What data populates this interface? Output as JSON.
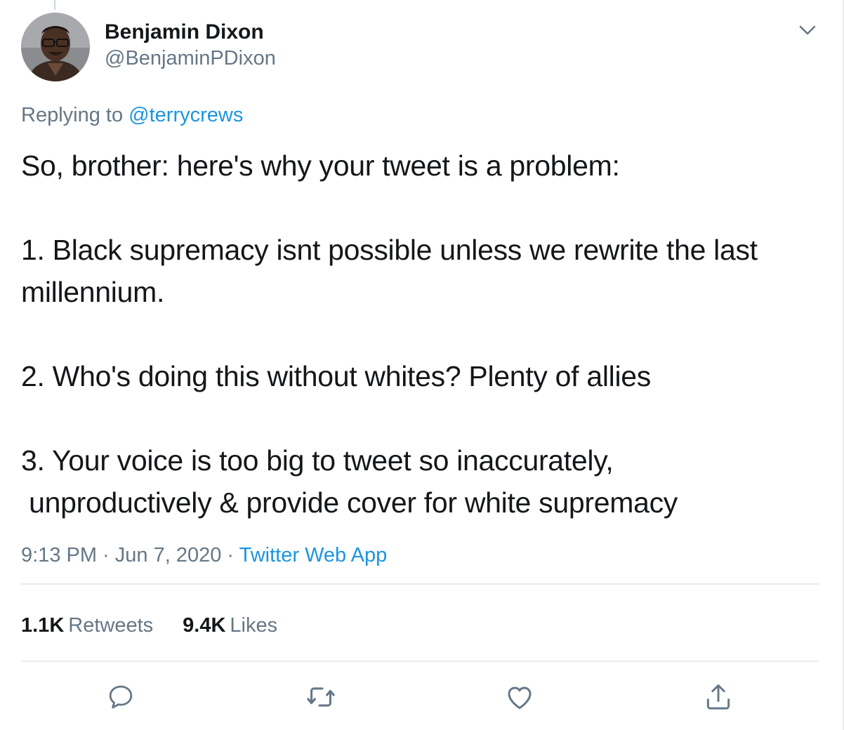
{
  "author": {
    "display_name": "Benjamin Dixon",
    "handle": "@BenjaminPDixon"
  },
  "reply": {
    "prefix": "Replying to ",
    "to_handle": "@terrycrews"
  },
  "tweet": {
    "text": "So, brother: here's why your tweet is a problem:\n\n1. Black supremacy isnt possible unless we rewrite the last millennium.\n\n2. Who's doing this without whites? Plenty of allies\n\n3. Your voice is too big to tweet so inaccurately,\n unproductively & provide cover for white supremacy"
  },
  "meta": {
    "time": "9:13 PM",
    "separator_1": " · ",
    "date": "Jun 7, 2020",
    "separator_2": " · ",
    "source": "Twitter Web App"
  },
  "stats": {
    "retweets_count": "1.1K",
    "retweets_label": "Retweets",
    "likes_count": "9.4K",
    "likes_label": "Likes"
  },
  "icons": {
    "caret": "chevron-down-icon",
    "reply": "reply-icon",
    "retweet": "retweet-icon",
    "like": "heart-icon",
    "share": "share-icon"
  },
  "colors": {
    "text": "#14171a",
    "secondary": "#657786",
    "link": "#1b95e0",
    "divider": "#e6ecf0"
  }
}
